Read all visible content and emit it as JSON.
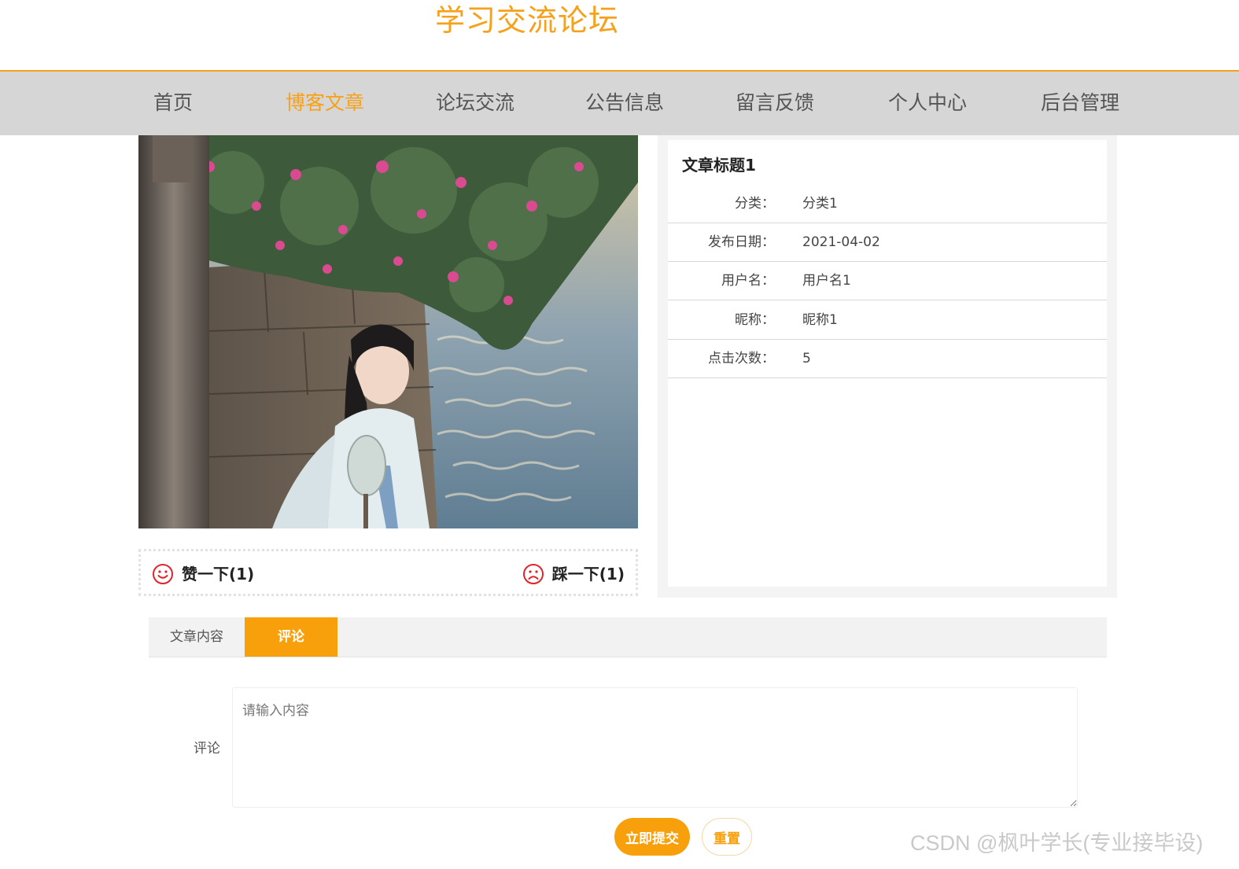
{
  "site": {
    "title": "学习交流论坛"
  },
  "nav": {
    "items": [
      {
        "label": "首页"
      },
      {
        "label": "博客文章",
        "active": true
      },
      {
        "label": "论坛交流"
      },
      {
        "label": "公告信息"
      },
      {
        "label": "留言反馈"
      },
      {
        "label": "个人中心"
      },
      {
        "label": "后台管理"
      }
    ]
  },
  "article": {
    "title": "文章标题1",
    "fields": [
      {
        "key": "分类：",
        "value": "分类1"
      },
      {
        "key": "发布日期：",
        "value": "2021-04-02"
      },
      {
        "key": "用户名：",
        "value": "用户名1"
      },
      {
        "key": "昵称：",
        "value": "昵称1"
      },
      {
        "key": "点击次数：",
        "value": "5"
      }
    ]
  },
  "votes": {
    "like_label": "赞一下(1)",
    "dislike_label": "踩一下(1)",
    "like_icon": "smile-icon",
    "dislike_icon": "frown-icon",
    "icon_color": "#e0242b"
  },
  "tabs": [
    {
      "label": "文章内容"
    },
    {
      "label": "评论",
      "active": true
    }
  ],
  "comment": {
    "label": "评论",
    "placeholder": "请输入内容",
    "submit_label": "立即提交",
    "reset_label": "重置"
  },
  "theme": {
    "accent": "#f7a11a",
    "nav_bg": "#d6d6d6"
  },
  "watermark": "CSDN @枫叶学长(专业接毕设)"
}
